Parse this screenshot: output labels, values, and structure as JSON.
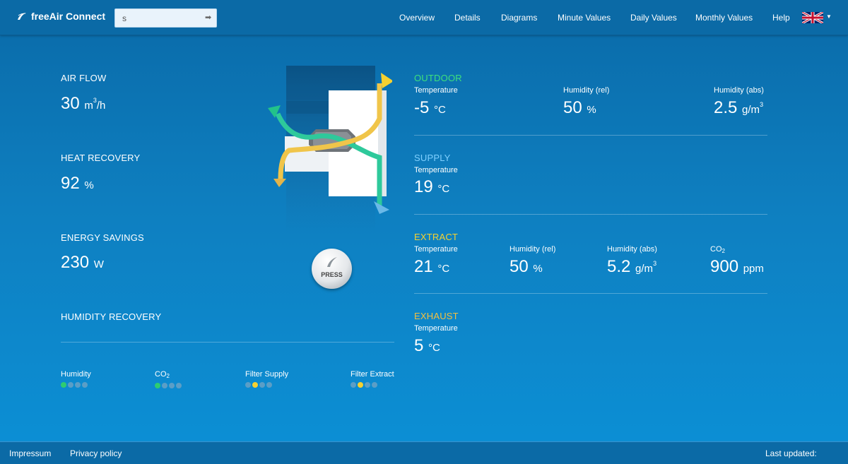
{
  "header": {
    "brand_name": "freeAir Connect",
    "search_value": "s",
    "nav": [
      {
        "label": "Overview"
      },
      {
        "label": "Details"
      },
      {
        "label": "Diagrams"
      },
      {
        "label": "Minute Values"
      },
      {
        "label": "Daily Values"
      },
      {
        "label": "Monthly Values"
      },
      {
        "label": "Help"
      }
    ],
    "language_icon": "uk-flag-icon"
  },
  "stats": {
    "air_flow": {
      "label": "AIR FLOW",
      "value": "30",
      "unit_base": "m",
      "unit_sup": "3",
      "unit_tail": "/h"
    },
    "heat_recovery": {
      "label": "HEAT RECOVERY",
      "value": "92",
      "unit": "%"
    },
    "energy_savings": {
      "label": "ENERGY SAVINGS",
      "value": "230",
      "unit": "W"
    },
    "humidity_recovery": {
      "label": "HUMIDITY RECOVERY"
    }
  },
  "indicators": [
    {
      "label": "Humidity",
      "level": 1,
      "color": "#2ecc71"
    },
    {
      "label_base": "CO",
      "label_sub": "2",
      "level": 1,
      "color": "#2ecc71"
    },
    {
      "label": "Filter Supply",
      "level": 2,
      "color": "#f5d130"
    },
    {
      "label": "Filter Extract",
      "level": 2,
      "color": "#f5d130"
    }
  ],
  "press_button": {
    "label": "PRESS"
  },
  "outdoor": {
    "title": "OUTDOOR",
    "temperature": {
      "label": "Temperature",
      "value": "-5",
      "unit": "°C"
    },
    "humidity_rel": {
      "label": "Humidity (rel)",
      "value": "50",
      "unit": "%"
    },
    "humidity_abs": {
      "label": "Humidity (abs)",
      "value": "2.5",
      "unit_base": "g/m",
      "unit_sup": "3"
    }
  },
  "supply": {
    "title": "SUPPLY",
    "temperature": {
      "label": "Temperature",
      "value": "19",
      "unit": "°C"
    }
  },
  "extract": {
    "title": "EXTRACT",
    "temperature": {
      "label": "Temperature",
      "value": "21",
      "unit": "°C"
    },
    "humidity_rel": {
      "label": "Humidity (rel)",
      "value": "50",
      "unit": "%"
    },
    "humidity_abs": {
      "label": "Humidity (abs)",
      "value": "5.2",
      "unit_base": "g/m",
      "unit_sup": "3"
    },
    "co2": {
      "label_base": "CO",
      "label_sub": "2",
      "value": "900",
      "unit": "ppm"
    }
  },
  "exhaust": {
    "title": "EXHAUST",
    "temperature": {
      "label": "Temperature",
      "value": "5",
      "unit": "°C"
    }
  },
  "footer": {
    "impressum": "Impressum",
    "privacy": "Privacy policy",
    "last_updated": "Last updated:"
  },
  "colors": {
    "outdoor": "#3ee07d",
    "supply": "#7fd0ff",
    "extract": "#f5d130",
    "exhaust": "#f2c040"
  }
}
